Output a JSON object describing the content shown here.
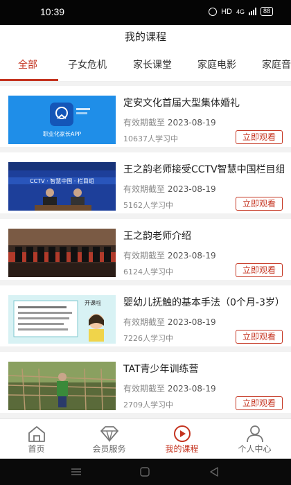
{
  "status": {
    "time": "10:39",
    "hd": "HD",
    "net": "4G",
    "battery": "88"
  },
  "header": {
    "title": "我的课程"
  },
  "tabs": [
    "全部",
    "子女危机",
    "家长课堂",
    "家庭电影",
    "家庭音"
  ],
  "courses": [
    {
      "title": "定安文化首届大型集体婚礼",
      "expiry_label": "有效期截至",
      "expiry_date": "2023-08-19",
      "learners": "10637人学习中",
      "button": "立即观看",
      "thumb_caption": "职业化家长APP"
    },
    {
      "title": "王之韵老师接受CCTV智慧中国栏目组专访",
      "expiry_label": "有效期截至",
      "expiry_date": "2023-08-19",
      "learners": "5162人学习中",
      "button": "立即观看",
      "thumb_caption": "CCTV · 智慧中国 · 栏目组"
    },
    {
      "title": "王之韵老师介绍",
      "expiry_label": "有效期截至",
      "expiry_date": "2023-08-19",
      "learners": "6124人学习中",
      "button": "立即观看",
      "thumb_caption": ""
    },
    {
      "title": "婴幼儿抚触的基本手法（0个月-3岁）",
      "expiry_label": "有效期截至",
      "expiry_date": "2023-08-19",
      "learners": "7226人学习中",
      "button": "立即观看",
      "thumb_caption": "开课啦"
    },
    {
      "title": "TAT青少年训练营",
      "expiry_label": "有效期截至",
      "expiry_date": "2023-08-19",
      "learners": "2709人学习中",
      "button": "立即观看",
      "thumb_caption": ""
    }
  ],
  "nav": [
    {
      "label": "首页",
      "icon": "home-icon"
    },
    {
      "label": "会员服务",
      "icon": "diamond-icon"
    },
    {
      "label": "我的课程",
      "icon": "play-icon"
    },
    {
      "label": "个人中心",
      "icon": "person-icon"
    }
  ],
  "colors": {
    "accent": "#c4331f",
    "status_bar": "#050505",
    "background": "#f2f2f2"
  }
}
